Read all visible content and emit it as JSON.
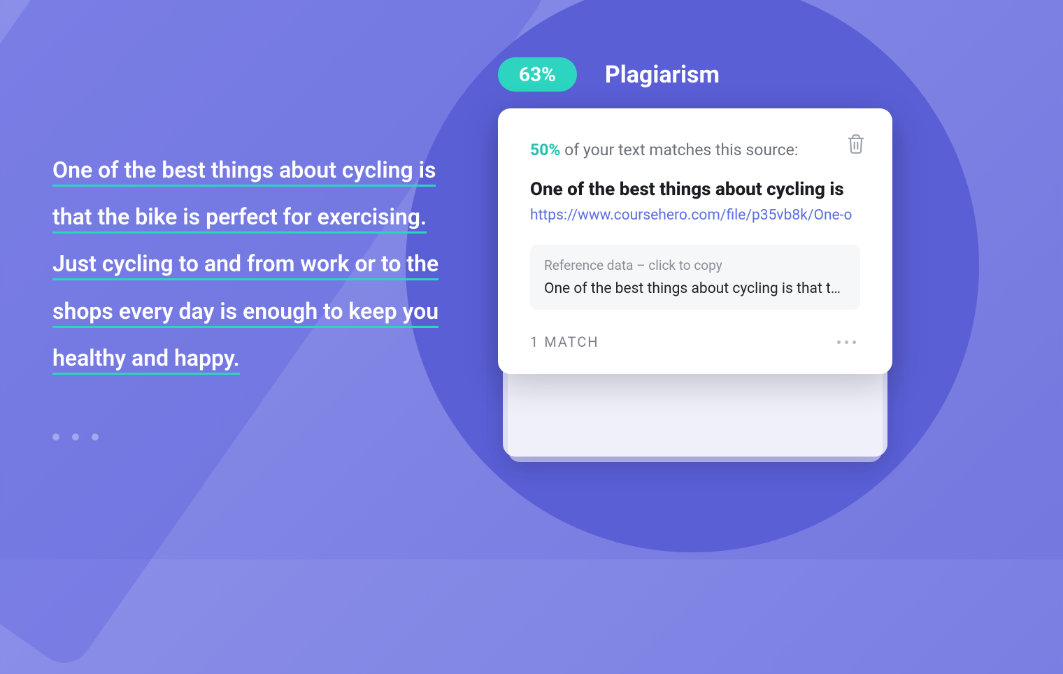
{
  "header": {
    "badge_percent": "63%",
    "title": "Plagiarism"
  },
  "sample": {
    "text": "One of the best things about cycling is that the bike is perfect for exercising. Just cycling to and from work or to the shops every day is enough to keep you healthy and happy."
  },
  "card": {
    "match_percent": "50%",
    "match_suffix": " of your text matches this source:",
    "source_title": "One of the best things about cycling is",
    "source_url": "https://www.coursehero.com/file/p35vb8k/One-o",
    "reference": {
      "label": "Reference data – click to copy",
      "text": "One of the best things about cycling is that the bike ..."
    },
    "footer": {
      "match_count": "1 MATCH"
    }
  },
  "icons": {
    "trash": "trash-icon",
    "more": "more-icon"
  }
}
